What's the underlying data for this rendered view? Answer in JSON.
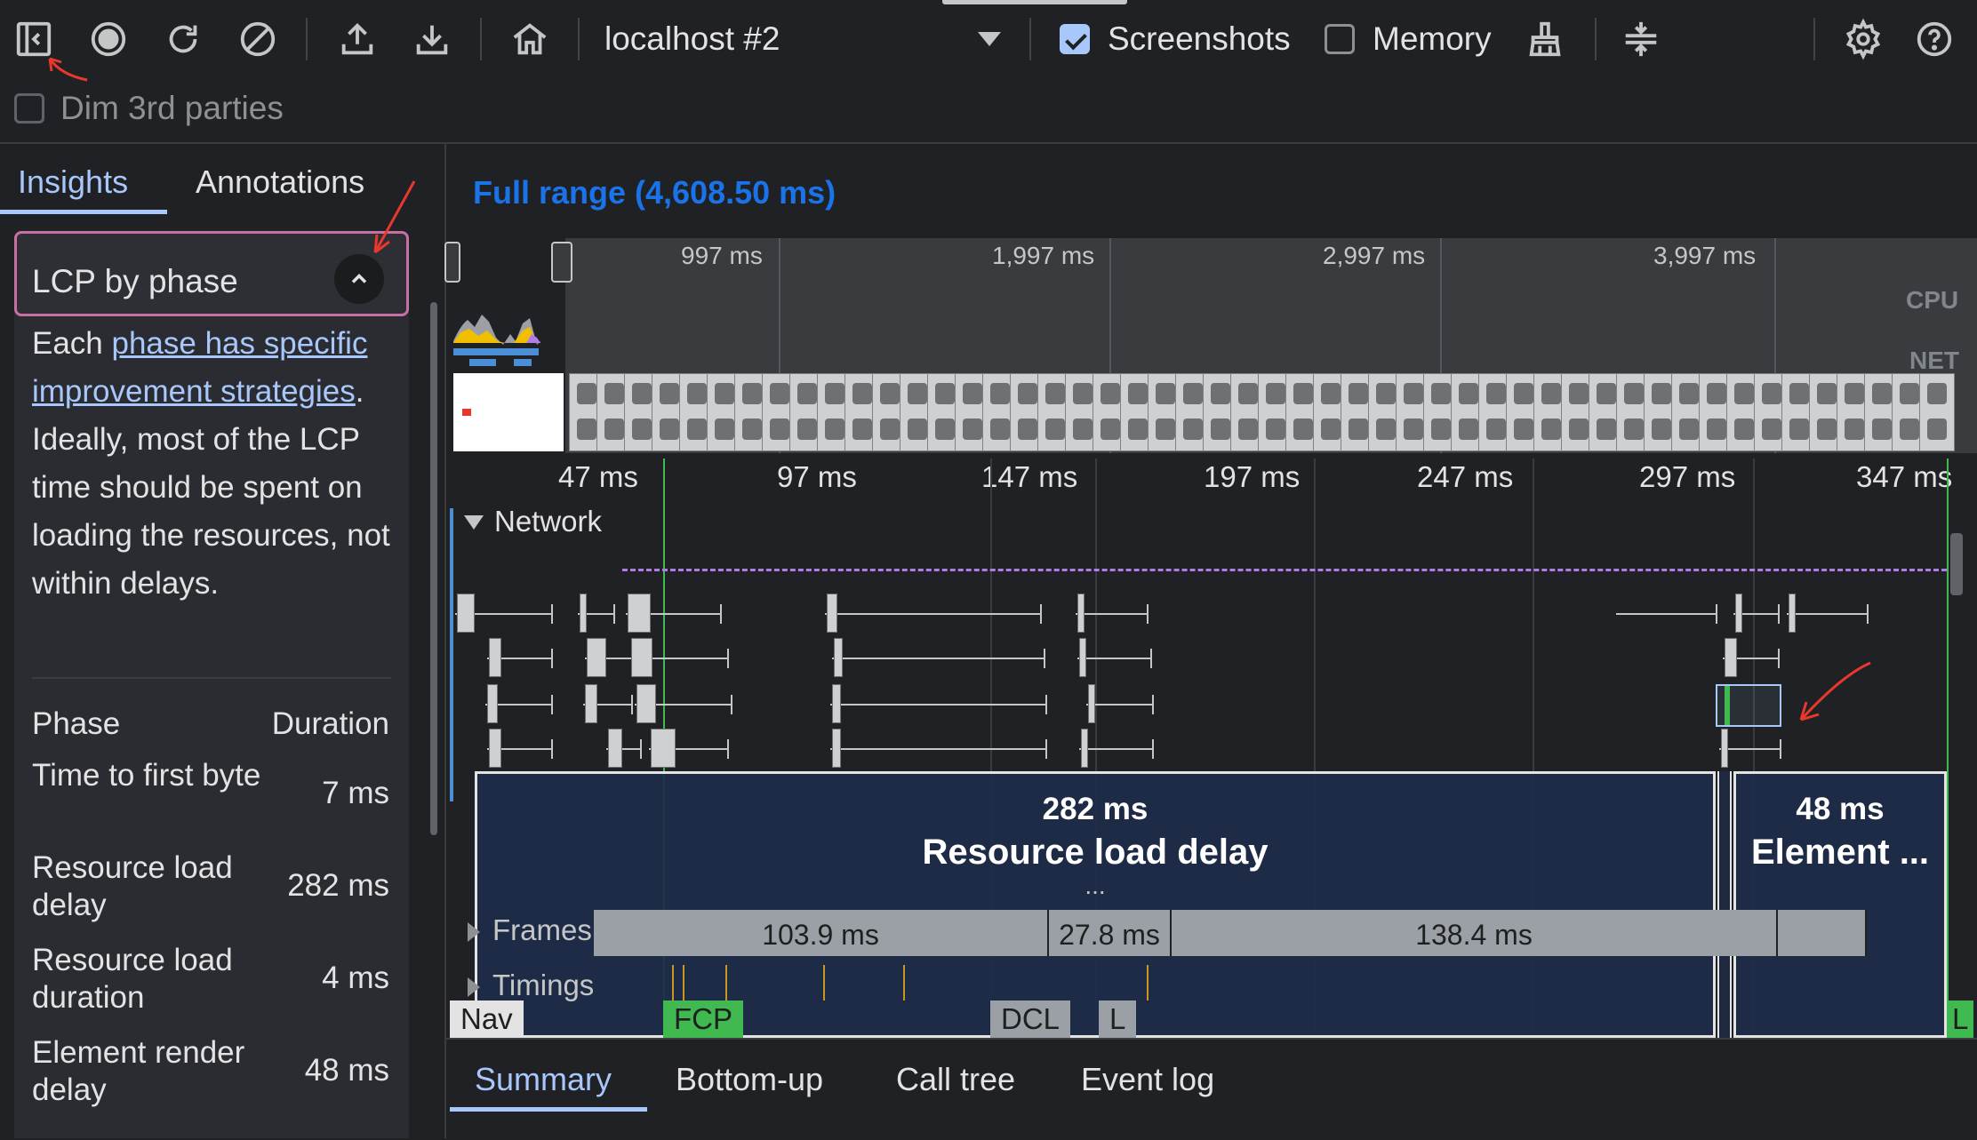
{
  "toolbar": {
    "buttons": [
      {
        "name": "toggle-sidebar-icon"
      },
      {
        "name": "record-icon"
      },
      {
        "name": "reload-icon"
      },
      {
        "name": "clear-icon"
      },
      {
        "name": "upload-icon"
      },
      {
        "name": "download-icon"
      },
      {
        "name": "home-icon"
      }
    ],
    "recording_select": "localhost #2",
    "screenshots_label": "Screenshots",
    "screenshots_checked": true,
    "memory_label": "Memory",
    "memory_checked": false,
    "dim_label": "Dim 3rd parties",
    "dim_checked": false
  },
  "sidebar": {
    "tabs": [
      "Insights",
      "Annotations"
    ],
    "active_tab": "Insights",
    "insight": {
      "title": "LCP by phase",
      "text_before": "Each ",
      "link_text": "phase has specific improvement strategies",
      "text_after": ". Ideally, most of the LCP time should be spent on loading the resources, not within delays.",
      "table_headers": [
        "Phase",
        "Duration"
      ],
      "phases": [
        {
          "label": "Time to first byte",
          "value": "7 ms"
        },
        {
          "label": "Resource load delay",
          "value": "282 ms"
        },
        {
          "label": "Resource load duration",
          "value": "4 ms"
        },
        {
          "label": "Element render delay",
          "value": "48 ms"
        }
      ]
    }
  },
  "main": {
    "range_label": "Full range (4,608.50 ms)",
    "overview_ticks": [
      "997 ms",
      "1,997 ms",
      "2,997 ms",
      "3,997 ms"
    ],
    "cpu_label": "CPU",
    "net_label": "NET",
    "ruler_ticks": [
      "47 ms",
      "97 ms",
      "147 ms",
      "197 ms",
      "247 ms",
      "297 ms",
      "347 ms"
    ],
    "network_label": "Network",
    "overlay_delay": {
      "duration": "282 ms",
      "label": "Resource load delay"
    },
    "overlay_render": {
      "duration": "48 ms",
      "label": "Element ..."
    },
    "overlay_more": "...",
    "frames_label": "Frames",
    "frames": [
      "103.9 ms",
      "27.8 ms",
      "138.4 ms"
    ],
    "timings_label": "Timings",
    "markers": [
      {
        "label": "Nav",
        "color": "#e3e3e3"
      },
      {
        "label": "FCP",
        "color": "#3fb950"
      },
      {
        "label": "DCL",
        "color": "#9aa0a6"
      },
      {
        "label": "L",
        "color": "#9aa0a6"
      },
      {
        "label": "L",
        "color": "#3fb950"
      }
    ]
  },
  "bottom_tabs": [
    "Summary",
    "Bottom-up",
    "Call tree",
    "Event log"
  ],
  "active_bottom_tab": "Summary",
  "colors": {
    "accent": "#a8c7fa",
    "annotation_red": "#e8382e",
    "highlight_pink": "#c870a4"
  }
}
